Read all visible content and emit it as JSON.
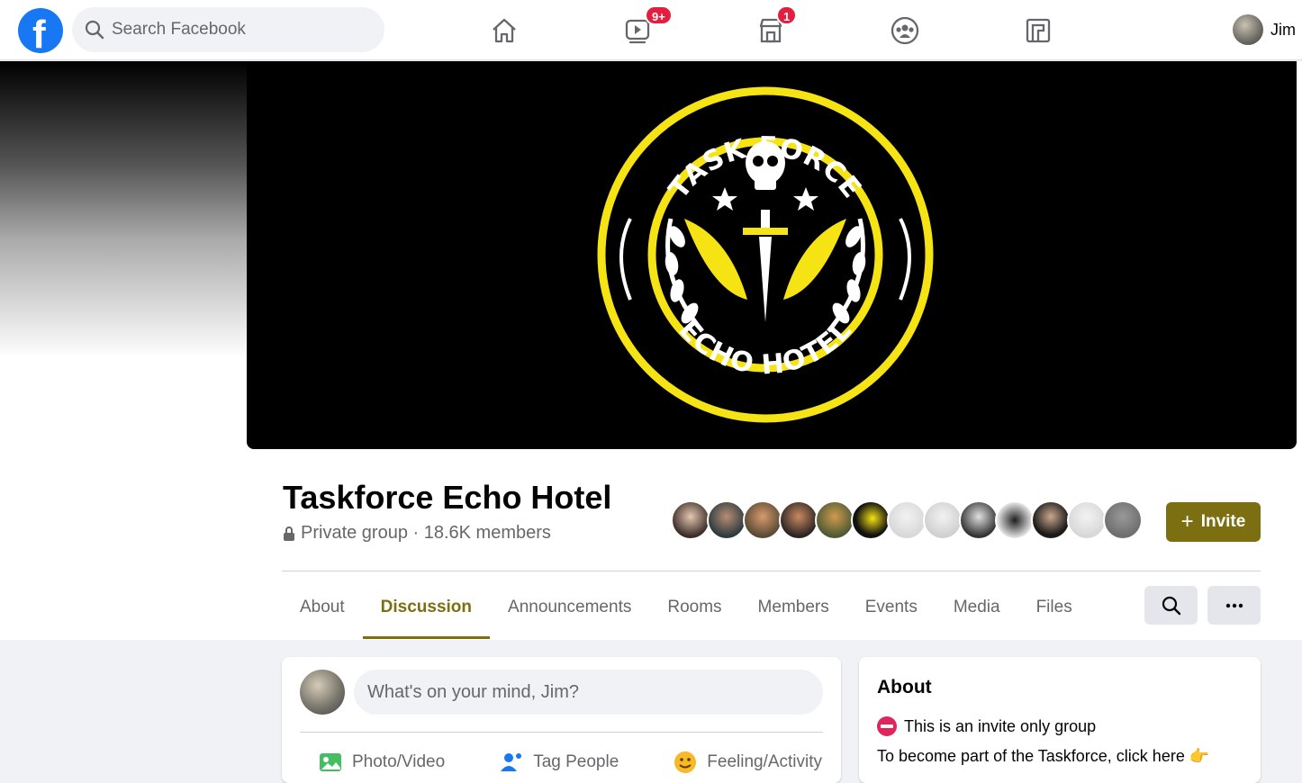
{
  "topbar": {
    "logo_letter": "f",
    "search_placeholder": "Search Facebook",
    "video_badge": "9+",
    "marketplace_badge": "1",
    "user_name": "Jim"
  },
  "group": {
    "name": "Taskforce Echo Hotel",
    "meta": "Private group · 18.6K members",
    "invite_label": "Invite",
    "cover_text_top": "TASK FORCE",
    "cover_text_bottom": "ECHO HOTEL",
    "accent_color": "#7c6f12",
    "member_avatars": 13
  },
  "tabs": [
    "About",
    "Discussion",
    "Announcements",
    "Rooms",
    "Members",
    "Events",
    "Media",
    "Files"
  ],
  "active_tab": "Discussion",
  "composer": {
    "placeholder": "What's on your mind, Jim?",
    "actions": [
      "Photo/Video",
      "Tag People",
      "Feeling/Activity"
    ]
  },
  "about": {
    "heading": "About",
    "line1": "This is an invite only group",
    "line2": "To become part of the Taskforce, click here 👉"
  }
}
